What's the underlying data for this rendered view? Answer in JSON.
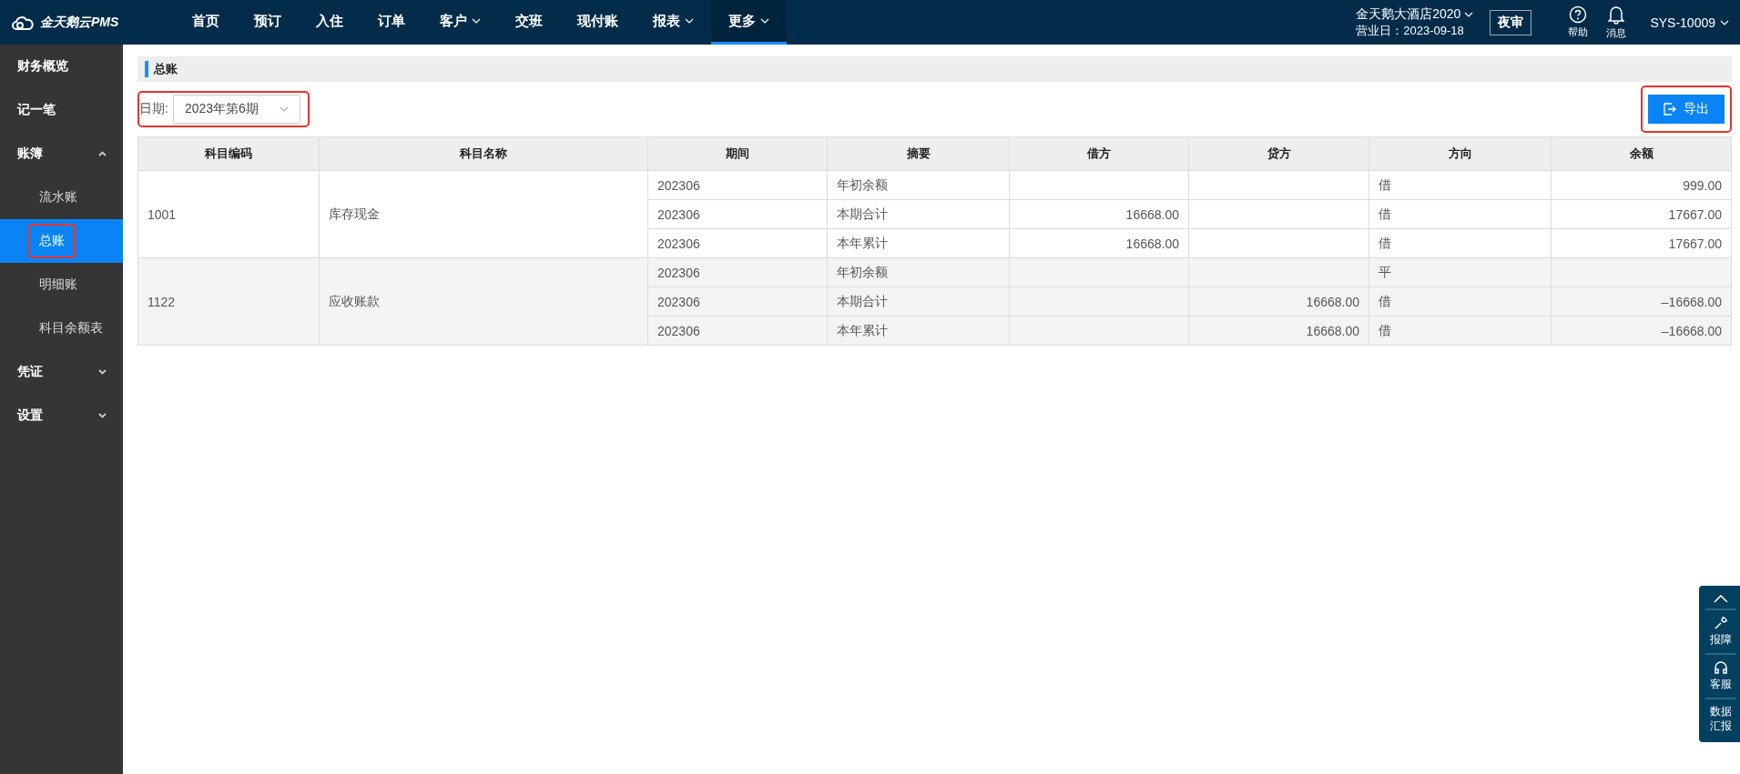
{
  "header": {
    "logo": "金天鹅云PMS",
    "nav": [
      {
        "label": "首页",
        "selected": false,
        "has_menu": false
      },
      {
        "label": "预订",
        "selected": false,
        "has_menu": false
      },
      {
        "label": "入住",
        "selected": false,
        "has_menu": false
      },
      {
        "label": "订单",
        "selected": false,
        "has_menu": false
      },
      {
        "label": "客户",
        "selected": false,
        "has_menu": true
      },
      {
        "label": "交班",
        "selected": false,
        "has_menu": false
      },
      {
        "label": "现付账",
        "selected": false,
        "has_menu": false
      },
      {
        "label": "报表",
        "selected": false,
        "has_menu": true
      },
      {
        "label": "更多",
        "selected": true,
        "has_menu": true
      }
    ],
    "hotel": "金天鹅大酒店2020",
    "business_date": "营业日：2023-09-18",
    "night_audit": "夜审",
    "help": "帮助",
    "messages": "消息",
    "user": "SYS-10009"
  },
  "sidebar": {
    "items": [
      {
        "label": "财务概览",
        "selected": false
      },
      {
        "label": "记一笔",
        "selected": false
      },
      {
        "label": "账簿",
        "selected": false,
        "expanded": true,
        "children": [
          {
            "label": "流水账",
            "selected": false
          },
          {
            "label": "总账",
            "selected": true
          },
          {
            "label": "明细账",
            "selected": false
          },
          {
            "label": "科目余额表",
            "selected": false
          }
        ]
      },
      {
        "label": "凭证",
        "selected": false,
        "expanded": false
      },
      {
        "label": "设置",
        "selected": false,
        "expanded": false
      }
    ]
  },
  "page": {
    "title": "总账",
    "date_label": "日期:",
    "date_value": "2023年第6期",
    "export": "导出"
  },
  "table": {
    "columns": [
      "科目编码",
      "科目名称",
      "期间",
      "摘要",
      "借方",
      "贷方",
      "方向",
      "余额"
    ],
    "groups": [
      {
        "code": "1001",
        "name": "库存现金",
        "rows": [
          {
            "period": "202306",
            "summary": "年初余额",
            "direction": "借",
            "balance": "999.00"
          },
          {
            "period": "202306",
            "summary": "本期合计",
            "debit": "16668.00",
            "direction": "借",
            "balance": "17667.00"
          },
          {
            "period": "202306",
            "summary": "本年累计",
            "debit": "16668.00",
            "direction": "借",
            "balance": "17667.00"
          }
        ]
      },
      {
        "code": "1122",
        "name": "应收账款",
        "rows": [
          {
            "period": "202306",
            "summary": "年初余额",
            "direction": "平"
          },
          {
            "period": "202306",
            "summary": "本期合计",
            "credit": "16668.00",
            "direction": "借",
            "balance": "–16668.00"
          },
          {
            "period": "202306",
            "summary": "本年累计",
            "credit": "16668.00",
            "direction": "借",
            "balance": "–16668.00"
          }
        ]
      }
    ]
  },
  "float_panel": {
    "report_issue": "报障",
    "service": "客服",
    "data_report": "数据汇报"
  }
}
